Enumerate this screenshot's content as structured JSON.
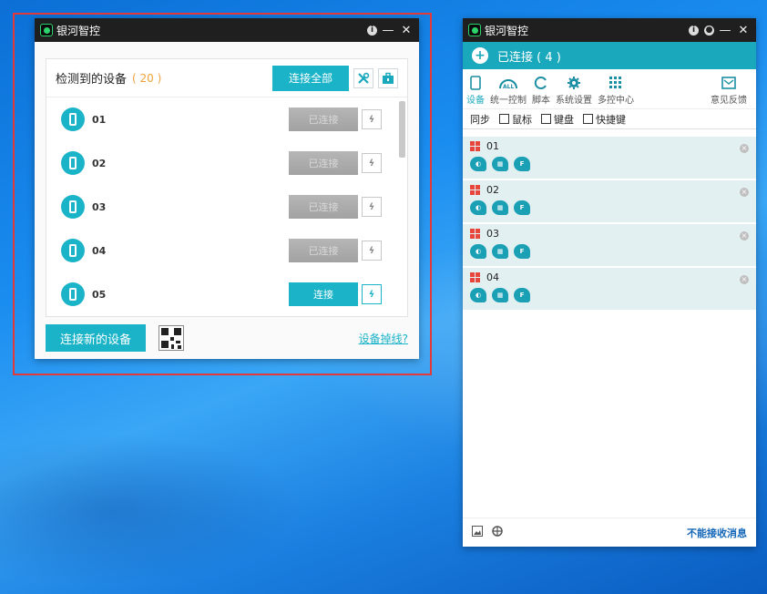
{
  "left_window": {
    "title": "银河智控",
    "panel_title": "检测到的设备",
    "device_count": "( 20 )",
    "connect_all_label": "连接全部",
    "devices": [
      {
        "name": "01",
        "status": "已连接",
        "state": "connected"
      },
      {
        "name": "02",
        "status": "已连接",
        "state": "connected"
      },
      {
        "name": "03",
        "status": "已连接",
        "state": "connected"
      },
      {
        "name": "04",
        "status": "已连接",
        "state": "connected"
      },
      {
        "name": "05",
        "status": "连接",
        "state": "connect"
      }
    ],
    "connect_new_label": "连接新的设备",
    "dropped_link": "设备掉线?"
  },
  "right_window": {
    "title": "银河智控",
    "connected_label": "已连接 ( 4 )",
    "tools": [
      {
        "label": "设备",
        "icon": "phone-icon"
      },
      {
        "label": "统一控制",
        "icon": "all-control-icon"
      },
      {
        "label": "脚本",
        "icon": "script-icon"
      },
      {
        "label": "系统设置",
        "icon": "gear-icon"
      },
      {
        "label": "多控中心",
        "icon": "grid-icon"
      },
      {
        "label": "意见反馈",
        "icon": "mail-icon"
      }
    ],
    "sync_label": "同步",
    "sync_options": [
      "鼠标",
      "键盘",
      "快捷键"
    ],
    "connected_devices": [
      "01",
      "02",
      "03",
      "04"
    ],
    "cannot_receive": "不能接收消息"
  },
  "colors": {
    "accent": "#1ab3c8",
    "titlebar": "#1f1f1f",
    "highlight_frame": "#e23a3a",
    "count_orange": "#f0a23a"
  }
}
